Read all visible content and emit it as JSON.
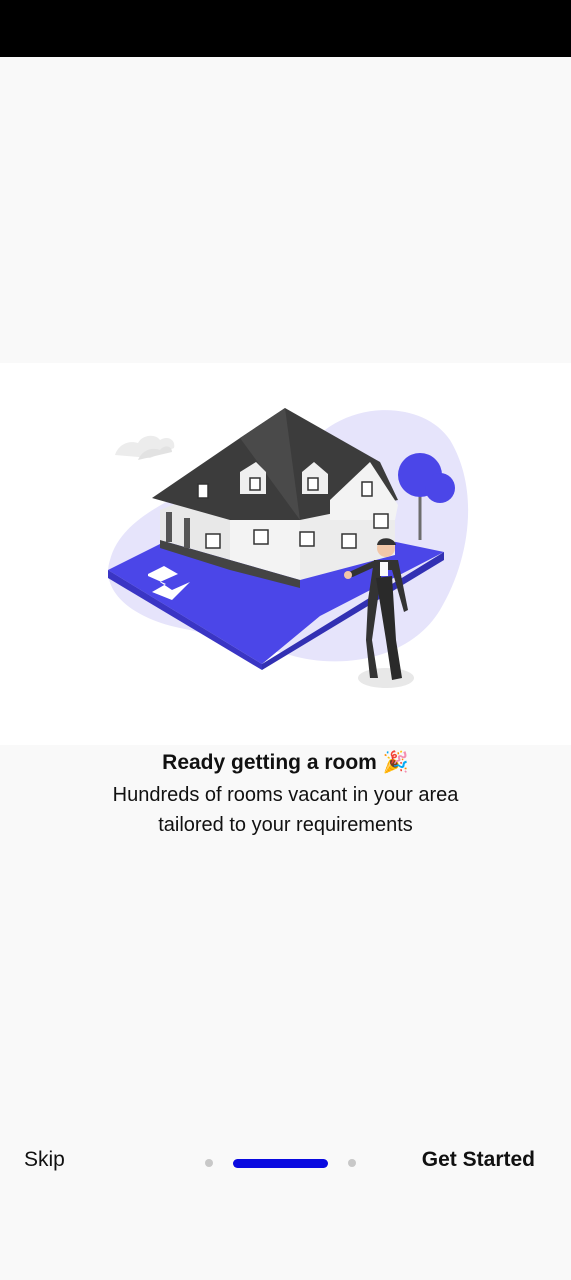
{
  "onboarding": {
    "title": "Ready getting a room 🎉",
    "subtitle_line1": "Hundreds of rooms vacant in your area",
    "subtitle_line2": "tailored to your requirements",
    "illustration_icon": "house-with-person-illustration"
  },
  "navigation": {
    "skip_label": "Skip",
    "get_started_label": "Get Started",
    "page_count": 3,
    "active_page": 2
  },
  "colors": {
    "accent": "#0a0ae0",
    "illustration_blue": "#4b46e8",
    "illustration_lavender": "#e6e4fb",
    "roof": "#3c3c3c",
    "inactive_dot": "#c8c8c8"
  }
}
